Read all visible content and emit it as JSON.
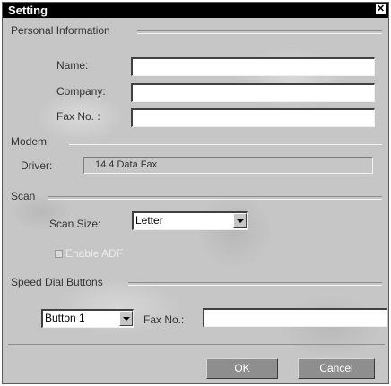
{
  "window": {
    "title": "Setting",
    "close_glyph": "✕",
    "close_icon": "close-icon"
  },
  "personal": {
    "title": "Personal Information",
    "name_label": "Name:",
    "name_value": "",
    "company_label": "Company:",
    "company_value": "",
    "fax_label": "Fax No. :",
    "fax_value": ""
  },
  "modem": {
    "title": "Modem",
    "driver_label": "Driver:",
    "driver_value": "14.4 Data Fax"
  },
  "scan": {
    "title": "Scan",
    "size_label": "Scan Size:",
    "size_value": "Letter",
    "adf_label": "Enable ADF",
    "adf_checked": false,
    "adf_enabled": false
  },
  "speed": {
    "title": "Speed Dial Buttons",
    "button_value": "Button 1",
    "fax_label": "Fax No.:",
    "fax_value": ""
  },
  "buttons": {
    "ok": "OK",
    "cancel": "Cancel"
  }
}
